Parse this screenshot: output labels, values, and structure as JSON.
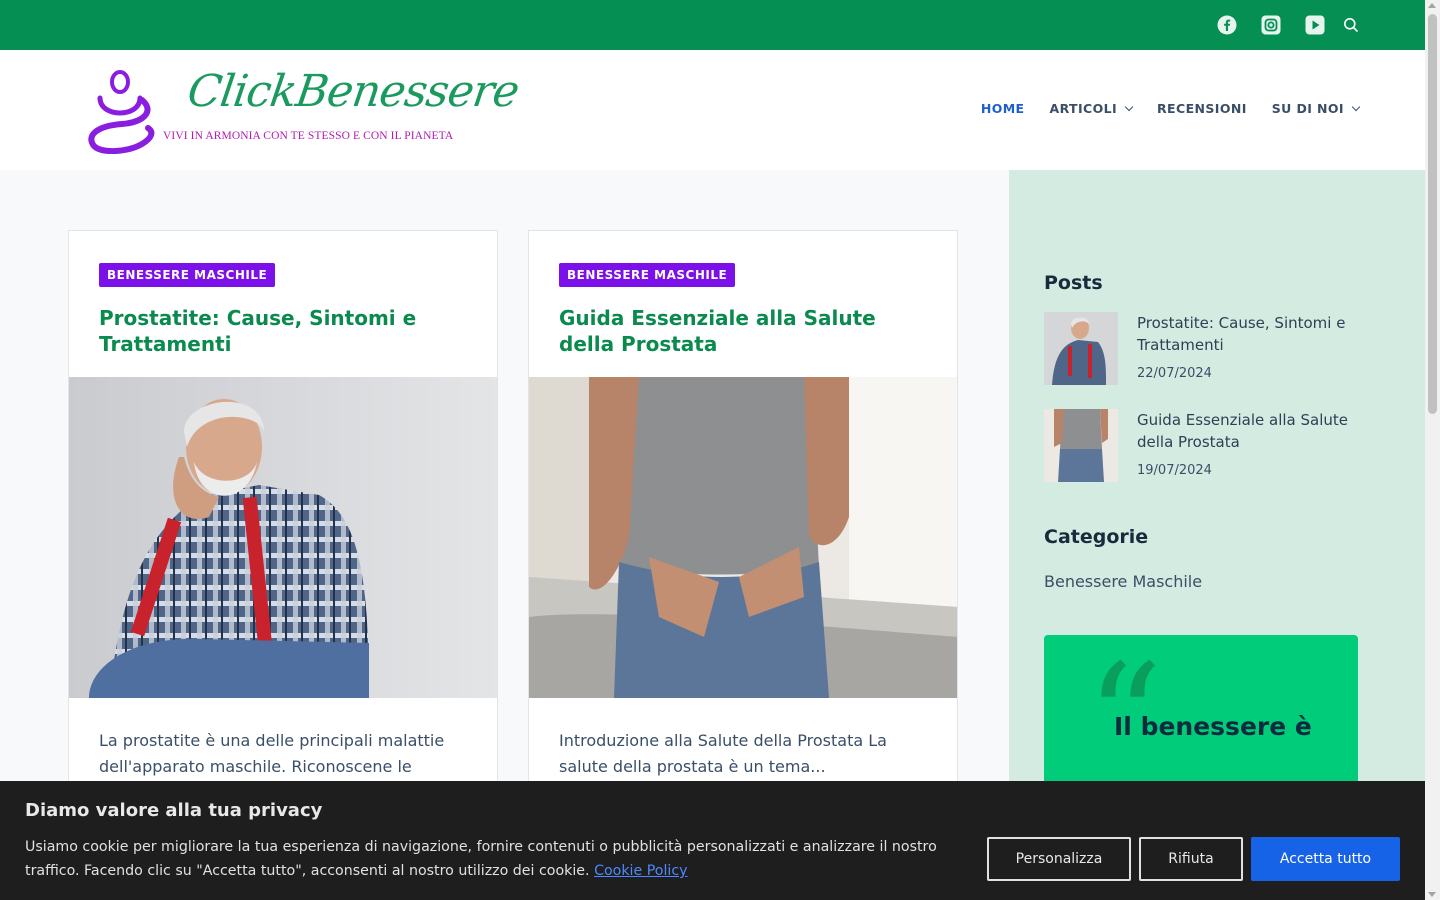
{
  "topbar": {
    "icons": [
      "facebook-icon",
      "instagram-icon",
      "youtube-icon",
      "search-icon"
    ],
    "bg_color": "#068f52"
  },
  "header": {
    "logo_name": "ClickBenessere",
    "logo_tagline": "VIVI IN ARMONIA CON TE STESSO E CON IL PIANETA",
    "nav": [
      {
        "label": "HOME",
        "active": true,
        "has_dropdown": false
      },
      {
        "label": "ARTICOLI",
        "active": false,
        "has_dropdown": true
      },
      {
        "label": "RECENSIONI",
        "active": false,
        "has_dropdown": false
      },
      {
        "label": "SU DI NOI",
        "active": false,
        "has_dropdown": true
      }
    ]
  },
  "articles": [
    {
      "category": "BENESSERE MASCHILE",
      "title": "Prostatite: Cause, Sintomi e Trattamenti",
      "excerpt": "La prostatite è una delle principali malattie dell'apparato maschile. Riconoscene le"
    },
    {
      "category": "BENESSERE MASCHILE",
      "title": "Guida Essenziale alla Salute della Prostata",
      "excerpt": "Introduzione alla Salute della Prostata La salute della prostata è un tema..."
    }
  ],
  "sidebar": {
    "posts_heading": "Posts",
    "posts": [
      {
        "title": "Prostatite: Cause, Sintomi e Trattamenti",
        "date": "22/07/2024"
      },
      {
        "title": "Guida Essenziale alla Salute della Prostata",
        "date": "19/07/2024"
      }
    ],
    "categories_heading": "Categorie",
    "categories": [
      "Benessere Maschile"
    ],
    "quote_text": "Il benessere è"
  },
  "cookie_banner": {
    "heading": "Diamo valore alla tua privacy",
    "text": "Usiamo cookie per migliorare la tua esperienza di navigazione, fornire contenuti o pubblicità personalizzati e analizzare il nostro traffico. Facendo clic su \"Accetta tutto\", acconsenti al nostro utilizzo dei cookie.",
    "policy_link": "Cookie Policy",
    "buttons": {
      "customize": "Personalizza",
      "reject": "Rifiuta",
      "accept": "Accetta tutto"
    }
  },
  "colors": {
    "brand_green": "#068f52",
    "title_green": "#0b8a4f",
    "badge_purple": "#7b10e8",
    "nav_active": "#1e5fd0",
    "sidebar_bg": "#d4ebe1",
    "quote_bg": "#00cc7a",
    "accept_blue": "#1763e8"
  }
}
